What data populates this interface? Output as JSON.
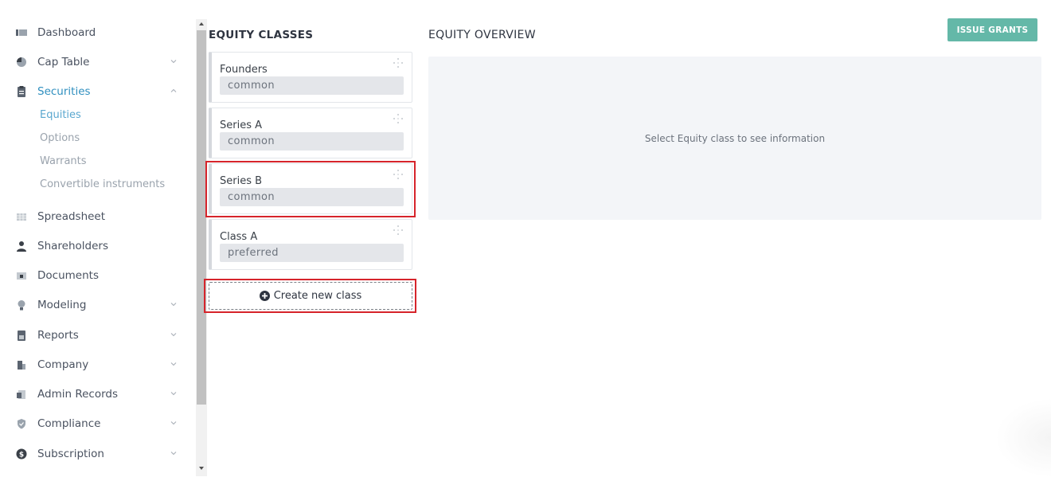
{
  "sidebar": {
    "items": [
      {
        "label": "Dashboard",
        "icon": "dashboard-icon",
        "has_chevron": false
      },
      {
        "label": "Cap Table",
        "icon": "pie-chart-icon",
        "has_chevron": true
      },
      {
        "label": "Securities",
        "icon": "clipboard-icon",
        "has_chevron": true,
        "expanded": true
      },
      {
        "label": "Spreadsheet",
        "icon": "spreadsheet-icon",
        "has_chevron": false
      },
      {
        "label": "Shareholders",
        "icon": "person-icon",
        "has_chevron": false
      },
      {
        "label": "Documents",
        "icon": "folder-icon",
        "has_chevron": false
      },
      {
        "label": "Modeling",
        "icon": "lightbulb-icon",
        "has_chevron": true
      },
      {
        "label": "Reports",
        "icon": "report-icon",
        "has_chevron": true
      },
      {
        "label": "Company",
        "icon": "building-icon",
        "has_chevron": true
      },
      {
        "label": "Admin Records",
        "icon": "records-icon",
        "has_chevron": true
      },
      {
        "label": "Compliance",
        "icon": "shield-icon",
        "has_chevron": true
      },
      {
        "label": "Subscription",
        "icon": "dollar-icon",
        "has_chevron": true
      }
    ],
    "sub_items": [
      {
        "label": "Equities"
      },
      {
        "label": "Options"
      },
      {
        "label": "Warrants"
      },
      {
        "label": "Convertible instruments"
      }
    ]
  },
  "equity_classes": {
    "title": "EQUITY CLASSES",
    "classes": [
      {
        "name": "Founders",
        "type": "common"
      },
      {
        "name": "Series A",
        "type": "common"
      },
      {
        "name": "Series B",
        "type": "common"
      },
      {
        "name": "Class A",
        "type": "preferred"
      }
    ],
    "create_label": "Create new class"
  },
  "overview": {
    "title": "EQUITY OVERVIEW",
    "placeholder": "Select Equity class to see information",
    "issue_label": "ISSUE GRANTS"
  },
  "colors": {
    "accent": "#2f8fbf",
    "issue_button": "#64b8a8",
    "highlight": "#d6242b"
  }
}
